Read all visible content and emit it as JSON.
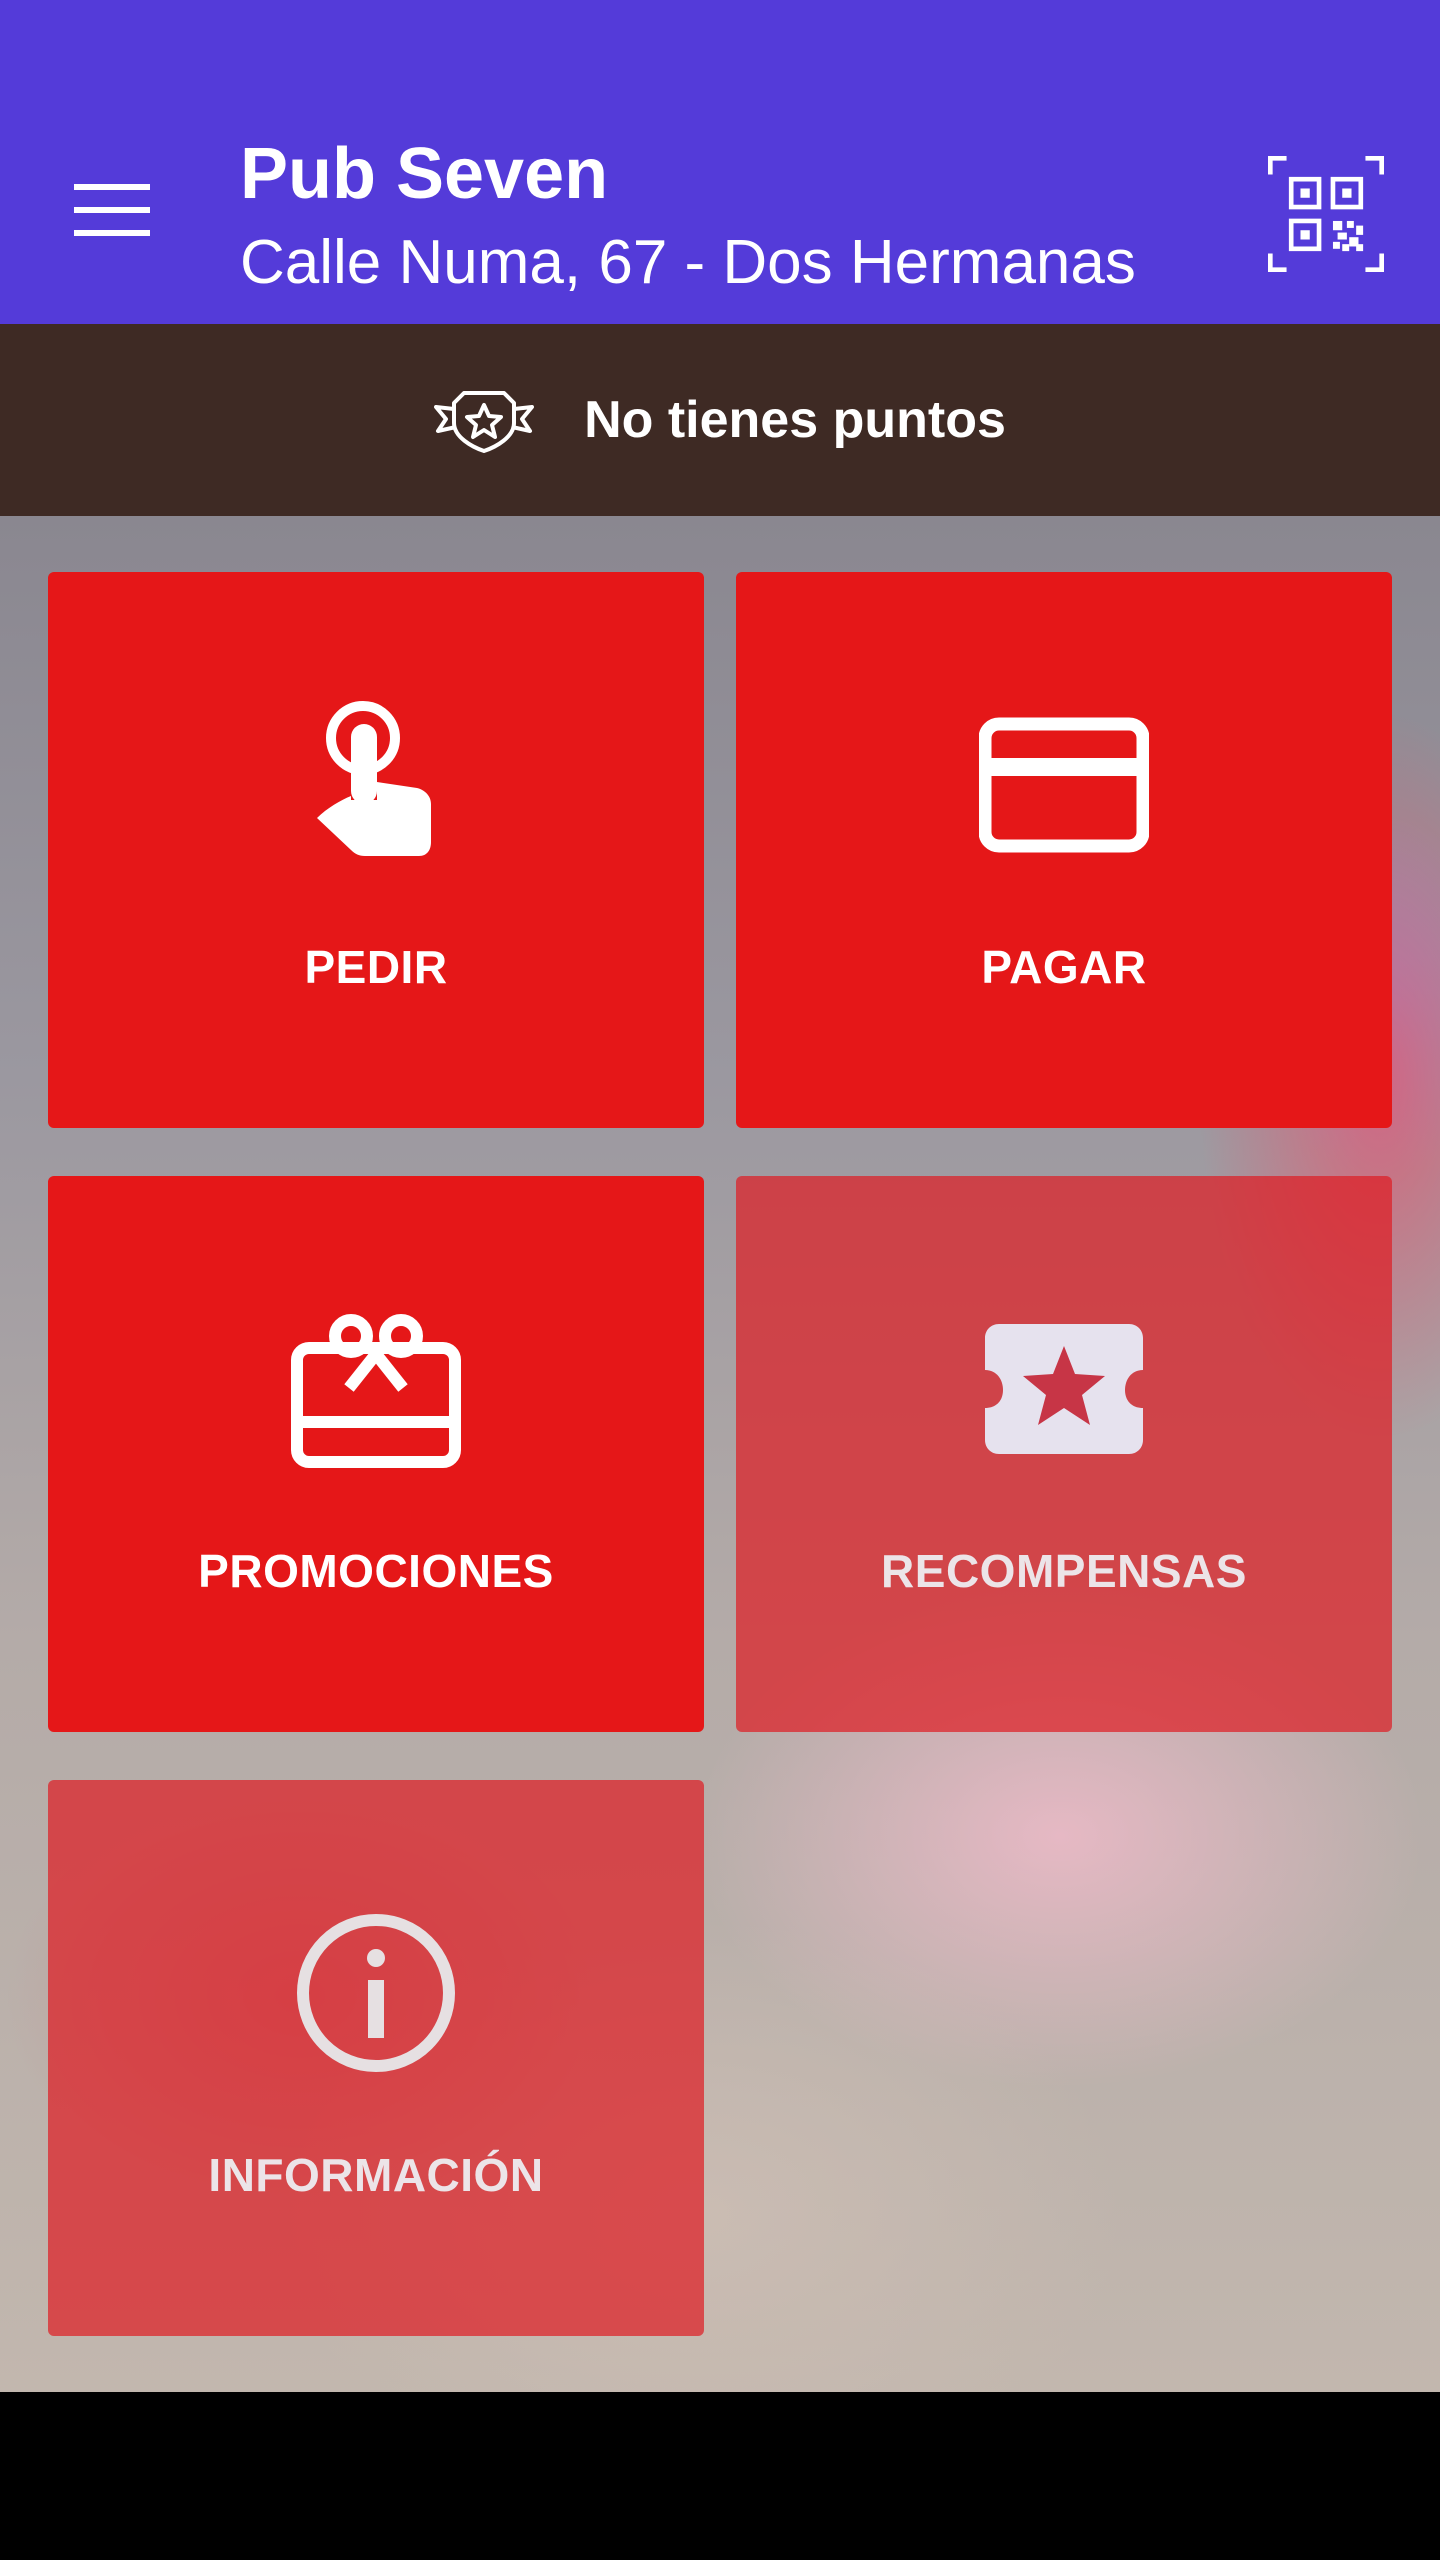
{
  "appbar": {
    "title": "Pub Seven",
    "subtitle": "Calle Numa, 67 - Dos Hermanas",
    "background": "#543BD9",
    "menu_icon": "hamburger-menu-icon",
    "qr_icon": "qr-code-scan-icon"
  },
  "points": {
    "text": "No tienes puntos",
    "icon": "badge-star-icon",
    "background": "#3E2A24"
  },
  "tiles": [
    {
      "label": "PEDIR",
      "icon": "touch-hand-icon",
      "enabled": true
    },
    {
      "label": "PAGAR",
      "icon": "credit-card-icon",
      "enabled": true
    },
    {
      "label": "PROMOCIONES",
      "icon": "gift-card-icon",
      "enabled": true
    },
    {
      "label": "RECOMPENSAS",
      "icon": "star-ticket-icon",
      "enabled": false
    },
    {
      "label": "INFORMACIÓN",
      "icon": "info-circle-icon",
      "enabled": false
    }
  ],
  "colors": {
    "tile_active": "#E51718",
    "tile_disabled": "rgba(222,30,38,0.72)"
  }
}
